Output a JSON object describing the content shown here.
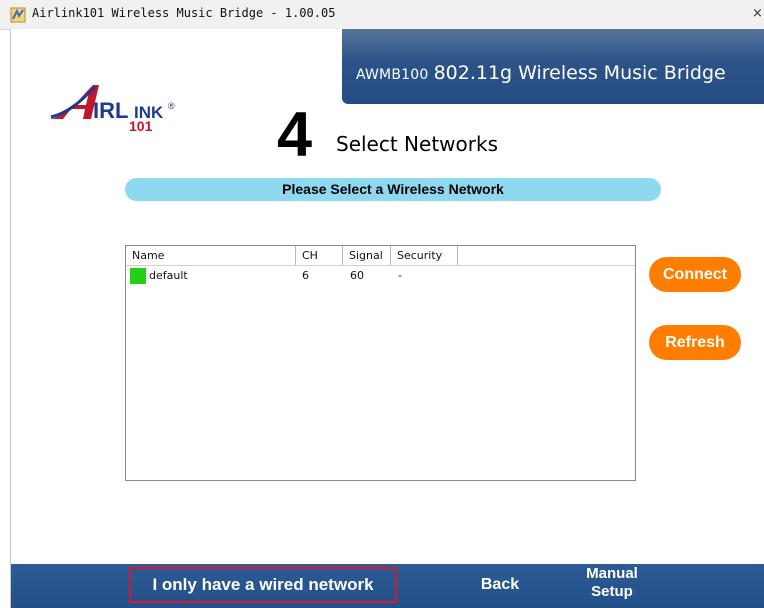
{
  "window": {
    "title": "Airlink101 Wireless Music Bridge - 1.00.05",
    "close_glyph": "×"
  },
  "header": {
    "banner_model": "AWMB100",
    "banner_description": "802.11g Wireless Music Bridge",
    "logo": "AirLink 101"
  },
  "step": {
    "number": "4",
    "title": "Select Networks",
    "instruction": "Please Select a Wireless Network"
  },
  "network_list": {
    "columns": [
      "Name",
      "CH",
      "Signal",
      "Security"
    ],
    "rows": [
      {
        "name": "default",
        "channel": "6",
        "signal": "60",
        "security": "-",
        "status_color": "#22d015"
      }
    ]
  },
  "actions": {
    "connect_label": "Connect",
    "refresh_label": "Refresh"
  },
  "footer": {
    "wired_label": "I only have a wired network",
    "back_label": "Back",
    "manual_label_line1": "Manual",
    "manual_label_line2": "Setup"
  },
  "colors": {
    "banner": "#2c5388",
    "pill": "#8ed8f0",
    "action_button": "#ff7e00",
    "footer": "#234f88",
    "highlight_border": "#d41a2c"
  }
}
